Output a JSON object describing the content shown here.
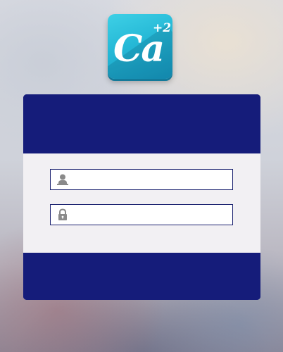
{
  "logo": {
    "text": "Ca",
    "superscript": "+2",
    "icon": "app-logo-icon"
  },
  "login_form": {
    "username": {
      "icon": "user-icon",
      "value": "",
      "placeholder": ""
    },
    "password": {
      "icon": "lock-icon",
      "value": "",
      "placeholder": ""
    }
  },
  "colors": {
    "panel_primary": "#151c7a",
    "form_background": "#f2f0f3",
    "logo_teal": "#25b8d6",
    "icon_gray": "#8a8a8a"
  }
}
